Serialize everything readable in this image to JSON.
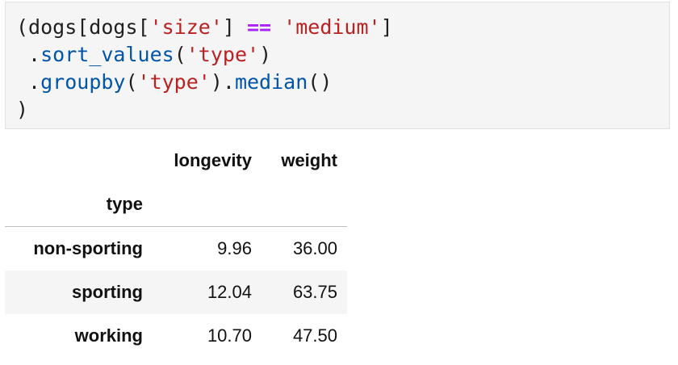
{
  "code_cell": {
    "lines": [
      [
        {
          "t": "(dogs[dogs[",
          "c": "p"
        },
        {
          "t": "'size'",
          "c": "str"
        },
        {
          "t": "] ",
          "c": "p"
        },
        {
          "t": "==",
          "c": "op"
        },
        {
          "t": " ",
          "c": "p"
        },
        {
          "t": "'medium'",
          "c": "str"
        },
        {
          "t": "]",
          "c": "p"
        }
      ],
      [
        {
          "t": " .",
          "c": "p"
        },
        {
          "t": "sort_values",
          "c": "fn"
        },
        {
          "t": "(",
          "c": "p"
        },
        {
          "t": "'type'",
          "c": "str"
        },
        {
          "t": ")",
          "c": "p"
        }
      ],
      [
        {
          "t": " .",
          "c": "p"
        },
        {
          "t": "groupby",
          "c": "fn"
        },
        {
          "t": "(",
          "c": "p"
        },
        {
          "t": "'type'",
          "c": "str"
        },
        {
          "t": ").",
          "c": "p"
        },
        {
          "t": "median",
          "c": "fn"
        },
        {
          "t": "()",
          "c": "p"
        }
      ],
      [
        {
          "t": ")",
          "c": "p"
        }
      ]
    ]
  },
  "output_table": {
    "columns": [
      "longevity",
      "weight"
    ],
    "index_name": "type",
    "rows": [
      {
        "index": "non-sporting",
        "longevity": "9.96",
        "weight": "36.00"
      },
      {
        "index": "sporting",
        "longevity": "12.04",
        "weight": "63.75"
      },
      {
        "index": "working",
        "longevity": "10.70",
        "weight": "47.50"
      }
    ]
  },
  "colors": {
    "string": "#ba2121",
    "function": "#0055aa",
    "operator": "#aa22ff",
    "cell_background": "#f5f5f5",
    "row_stripe": "#f5f5f5"
  }
}
